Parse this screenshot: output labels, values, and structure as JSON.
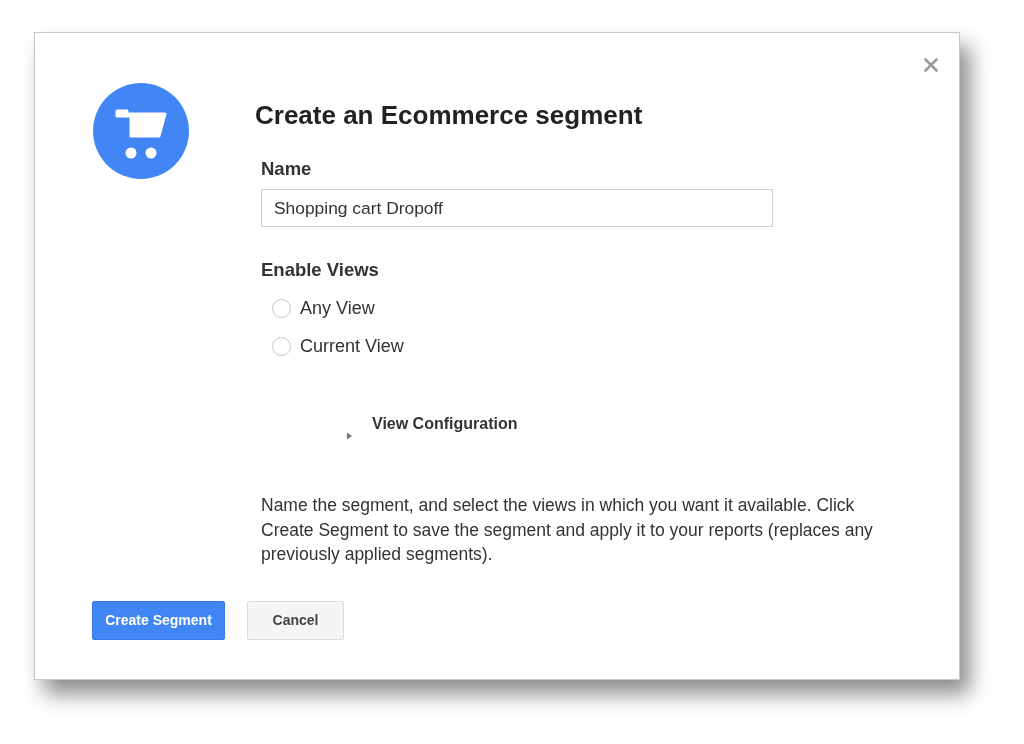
{
  "dialog": {
    "title": "Create an Ecommerce segment",
    "name_field": {
      "label": "Name",
      "value": "Shopping cart Dropoff"
    },
    "enable_views": {
      "label": "Enable Views",
      "options": [
        {
          "label": "Any View",
          "selected": false
        },
        {
          "label": "Current View",
          "selected": false
        }
      ]
    },
    "view_configuration": {
      "label": "View Configuration",
      "expanded": false
    },
    "description": "Name the segment, and select the views in which you want it available. Click Create Segment to save the segment and apply it to your reports (replaces any previously applied segments).",
    "buttons": [
      {
        "label": "Create Segment",
        "kind": "primary"
      },
      {
        "label": "Cancel",
        "kind": "secondary"
      }
    ]
  }
}
